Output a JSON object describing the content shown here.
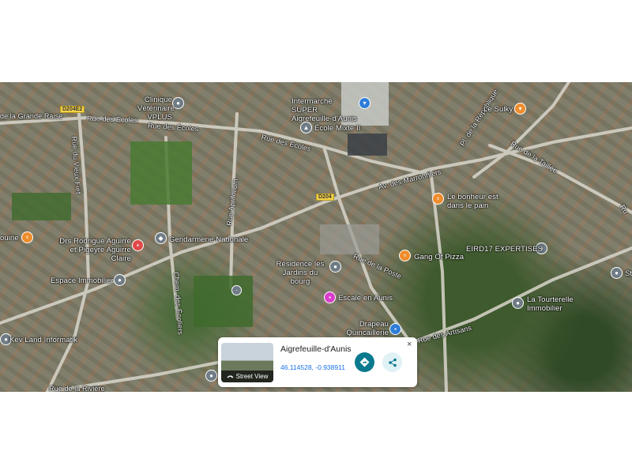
{
  "map": {
    "streets": {
      "rue_grande_raise": "de la Grande Raise",
      "d204e2": "D204E2",
      "rue_ecoles_1": "Rue des Écoles",
      "rue_ecoles_2": "Rue des Écoles",
      "rue_ecoles_3": "Rue des Écoles",
      "rue_vieux_fief": "Rue du Vieux Fief",
      "rue_aprifolium": "Rue Aprifolium",
      "av_marronniers": "Av. des Marronniers",
      "d204": "D204",
      "pl_republique": "Pl. de la République",
      "rue_taillee": "Rue de la Taillée",
      "rue_poste": "Rue de la Poste",
      "chem_ecoliers": "Chem. des Écoliers",
      "rue_artisans": "Rue des Artisans",
      "rue_riviere": "Rue de la Rivière",
      "rue_right": "Ru"
    },
    "places": {
      "clinique": "Clinique Vétérinaire VPLUS",
      "intermarche": "Intermarché SUPER Aigrefeuille-d'Aunis",
      "ecole": "École Mixte II",
      "le_sulky": "Le Sulky",
      "drs": "Drs Rodrigue Aguirre et Pigeyre Aguirre Claire",
      "gendarmerie": "Gendarmerie Nationale",
      "ouine": "ouine",
      "bonheur": "Le bonheur est dans le pain",
      "eird17": "EIRD17 EXPERTISES",
      "gang_pizza": "Gang Of Pizza",
      "residence": "Résidence les Jardins du bourg",
      "espace_immo": "Espace Immobilier",
      "escale": "Escale en Aunis",
      "tourterelle": "La Tourterelle Immobilier",
      "quincaillerie": "Drapeau Quincaillerie Ménage",
      "kev_land": "Kev Land Informatik",
      "st": "St"
    }
  },
  "card": {
    "title": "Aigrefeuille-d'Aunis",
    "coords": "46.114528, -0.938911",
    "street_view_label": "Street View",
    "close_label": "×"
  },
  "colors": {
    "directions_button": "#0b7a8e",
    "share_button": "#e0f2f5",
    "coords_link": "#1a73e8"
  },
  "icons": {
    "directions": "directions-icon",
    "share": "share-icon",
    "street_view": "street-view-icon",
    "close": "close-icon"
  }
}
